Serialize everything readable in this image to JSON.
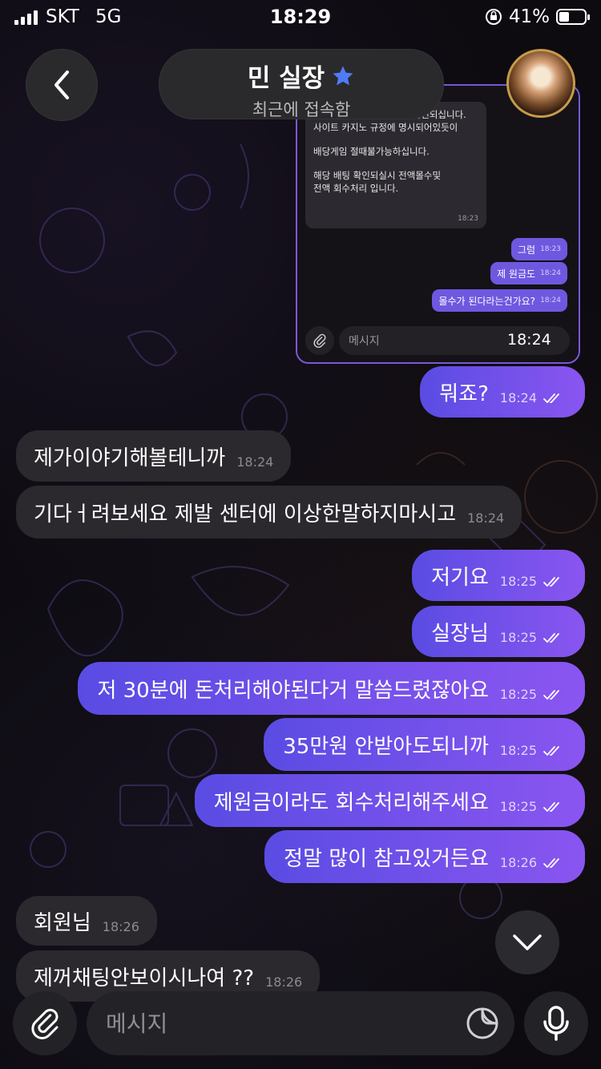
{
  "status_bar": {
    "carrier": "SKT",
    "network": "5G",
    "time": "18:29",
    "battery": "41%",
    "battery_level": 0.41
  },
  "header": {
    "title": "민 실장",
    "subtitle": "최근에 접속함",
    "star_color": "#4f7cf5"
  },
  "embedded": {
    "message_text_1": "배당게임 이용하신것으로 확인되십니다.",
    "message_text_2": "사이트 카지노 규정에 명시되어있듯이",
    "message_text_3": "배당게임 절때불가능하십니다.",
    "message_text_4": "해당 배팅 확인되실시 전액몰수및",
    "message_text_5": "전액 회수처리 입니다.",
    "message_time": "18:23",
    "out_messages": [
      {
        "text": "그럼",
        "time": "18:23"
      },
      {
        "text": "제 원금도",
        "time": "18:24"
      },
      {
        "text": "몰수가 된다라는건가요?",
        "time": "18:24"
      }
    ],
    "input_placeholder": "메시지",
    "overlay_time": "18:24"
  },
  "messages": [
    {
      "dir": "out",
      "text": "뭐죠?",
      "time": "18:24"
    },
    {
      "dir": "in",
      "text": "제가이야기해볼테니까",
      "time": "18:24"
    },
    {
      "dir": "in",
      "text": "기다ㅓ려보세요 제발 센터에 이상한말하지마시고",
      "time": "18:24"
    },
    {
      "dir": "out",
      "text": "저기요",
      "time": "18:25"
    },
    {
      "dir": "out",
      "text": "실장님",
      "time": "18:25"
    },
    {
      "dir": "out",
      "text": "저 30분에 돈처리해야된다거 말씀드렸잖아요",
      "time": "18:25"
    },
    {
      "dir": "out",
      "text": "35만원 안받아도되니까",
      "time": "18:25"
    },
    {
      "dir": "out",
      "text": "제원금이라도 회수처리해주세요",
      "time": "18:25"
    },
    {
      "dir": "out",
      "text": "정말 많이 참고있거든요",
      "time": "18:26"
    },
    {
      "dir": "in",
      "text": "회원님",
      "time": "18:26"
    },
    {
      "dir": "in",
      "text": "제꺼채팅안보이시나여 ??",
      "time": "18:26"
    }
  ],
  "composer": {
    "placeholder": "메시지"
  },
  "colors": {
    "outgoing_bubble_start": "#5a4ce3",
    "outgoing_bubble_end": "#8a55f0",
    "incoming_bubble": "#2b282e",
    "background": "#0d0b10"
  }
}
